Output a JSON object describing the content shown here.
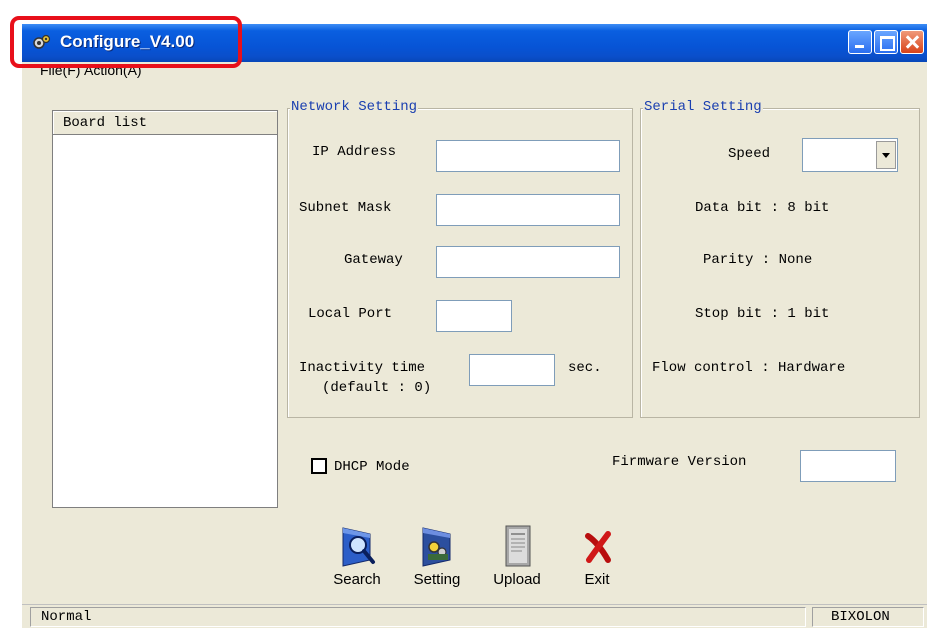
{
  "window": {
    "title": "Configure_V4.00",
    "min_icon": "minimize-icon",
    "max_icon": "maximize-icon",
    "close_icon": "close-icon"
  },
  "menu": {
    "file": "File(F)",
    "action": "Action(A)"
  },
  "board_list": {
    "header": "Board list",
    "items": []
  },
  "network_setting": {
    "legend": "Network Setting",
    "ip_address_label": "IP Address",
    "ip_address_value": "",
    "subnet_mask_label": "Subnet Mask",
    "subnet_mask_value": "",
    "gateway_label": "Gateway",
    "gateway_value": "",
    "local_port_label": "Local Port",
    "local_port_value": "",
    "inactivity_label": "Inactivity time",
    "inactivity_default": "(default : 0)",
    "inactivity_value": "",
    "inactivity_unit": "sec."
  },
  "serial_setting": {
    "legend": "Serial Setting",
    "speed_label": "Speed",
    "speed_value": "",
    "data_bit": "Data bit : 8 bit",
    "parity": "Parity : None",
    "stop_bit": "Stop bit : 1 bit",
    "flow_control": "Flow control : Hardware"
  },
  "dhcp": {
    "label": "DHCP Mode",
    "checked": false
  },
  "firmware": {
    "label": "Firmware Version",
    "value": ""
  },
  "toolbar": {
    "search": "Search",
    "setting": "Setting",
    "upload": "Upload",
    "exit": "Exit"
  },
  "status": {
    "left": "Normal",
    "right": "BIXOLON"
  },
  "colors": {
    "titlebar": "#0754d6",
    "face": "#ece9d8",
    "legend_text": "#1a3fb0",
    "highlight": "#e8101a"
  }
}
